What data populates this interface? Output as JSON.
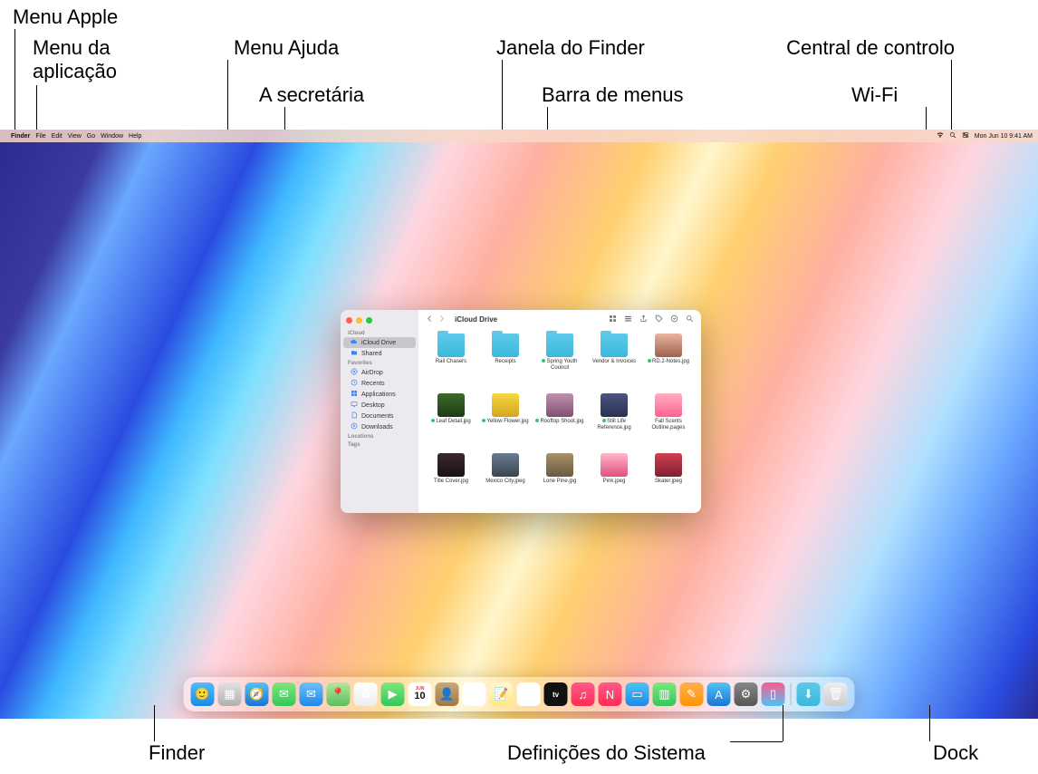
{
  "annotations": {
    "menu_apple": "Menu Apple",
    "menu_app": "Menu da\naplicação",
    "menu_help": "Menu Ajuda",
    "desktop": "A secretária",
    "finder_window": "Janela do Finder",
    "menubar": "Barra de menus",
    "control_center": "Central de controlo",
    "wifi": "Wi-Fi",
    "finder": "Finder",
    "sysprefs": "Definições do Sistema",
    "dock": "Dock"
  },
  "menubar": {
    "items": [
      "Finder",
      "File",
      "Edit",
      "View",
      "Go",
      "Window",
      "Help"
    ],
    "datetime": "Mon Jun 10  9:41 AM"
  },
  "finder": {
    "title": "iCloud Drive",
    "sidebar": {
      "sections": [
        {
          "name": "iCloud",
          "items": [
            {
              "label": "iCloud Drive",
              "icon": "cloud",
              "selected": true
            },
            {
              "label": "Shared",
              "icon": "folder-shared"
            }
          ]
        },
        {
          "name": "Favorites",
          "items": [
            {
              "label": "AirDrop",
              "icon": "airdrop"
            },
            {
              "label": "Recents",
              "icon": "clock"
            },
            {
              "label": "Applications",
              "icon": "app-grid"
            },
            {
              "label": "Desktop",
              "icon": "desktop"
            },
            {
              "label": "Documents",
              "icon": "doc"
            },
            {
              "label": "Downloads",
              "icon": "download"
            }
          ]
        },
        {
          "name": "Locations",
          "items": []
        },
        {
          "name": "Tags",
          "items": []
        }
      ]
    },
    "items": [
      {
        "label": "Rail Chasers",
        "type": "folder",
        "tagged": false
      },
      {
        "label": "Receipts",
        "type": "folder",
        "tagged": false
      },
      {
        "label": "Spring Youth Council",
        "type": "folder",
        "tagged": true
      },
      {
        "label": "Vendor & Invoices",
        "type": "folder",
        "tagged": false
      },
      {
        "label": "RD.2-Notes.jpg",
        "type": "image",
        "tagged": true,
        "bg": "linear-gradient(#e8b4a0,#a06050)"
      },
      {
        "label": "Leaf Detail.jpg",
        "type": "image",
        "tagged": true,
        "bg": "linear-gradient(#3a6b2a,#1e3a15)"
      },
      {
        "label": "Yellow Flower.jpg",
        "type": "image",
        "tagged": true,
        "bg": "linear-gradient(#f5d742,#d4a520)"
      },
      {
        "label": "Rooftop Shoot.jpg",
        "type": "image",
        "tagged": true,
        "bg": "linear-gradient(#c090b0,#805070)"
      },
      {
        "label": "Still Life Reference.jpg",
        "type": "image",
        "tagged": true,
        "bg": "linear-gradient(#4a5580,#2a3050)"
      },
      {
        "label": "Fall Scents Outline.pages",
        "type": "doc",
        "tagged": false,
        "bg": "linear-gradient(#ffb0c0,#ff6090)"
      },
      {
        "label": "Title Cover.jpg",
        "type": "image",
        "tagged": false,
        "bg": "linear-gradient(#3a2a30,#1a1015)"
      },
      {
        "label": "Mexico City.jpeg",
        "type": "image",
        "tagged": false,
        "bg": "linear-gradient(#6a7a90,#3a4550)"
      },
      {
        "label": "Lone Pine.jpg",
        "type": "image",
        "tagged": false,
        "bg": "linear-gradient(#a8906a,#6a5a40)"
      },
      {
        "label": "Pink.jpeg",
        "type": "image",
        "tagged": false,
        "bg": "linear-gradient(#ffb8c8,#e05080)"
      },
      {
        "label": "Skater.jpeg",
        "type": "image",
        "tagged": false,
        "bg": "linear-gradient(#d04050,#802030)"
      }
    ]
  },
  "dock": [
    {
      "name": "finder",
      "bg": "linear-gradient(#4ac0ff,#1e88e5)",
      "glyph": "🙂"
    },
    {
      "name": "launchpad",
      "bg": "linear-gradient(#e0e0e0,#b0b0b0)",
      "glyph": "▦"
    },
    {
      "name": "safari",
      "bg": "linear-gradient(#4fc3f7,#1976d2)",
      "glyph": "🧭"
    },
    {
      "name": "messages",
      "bg": "linear-gradient(#7ce87c,#34c759)",
      "glyph": "✉"
    },
    {
      "name": "mail",
      "bg": "linear-gradient(#6ec0ff,#1e88e5)",
      "glyph": "✉"
    },
    {
      "name": "maps",
      "bg": "linear-gradient(#b0e8a0,#5ac05a)",
      "glyph": "📍"
    },
    {
      "name": "photos",
      "bg": "linear-gradient(#fff,#eee)",
      "glyph": "✿"
    },
    {
      "name": "facetime",
      "bg": "linear-gradient(#7ce87c,#34c759)",
      "glyph": "▶"
    },
    {
      "name": "calendar",
      "bg": "#fff",
      "glyph": "10"
    },
    {
      "name": "contacts",
      "bg": "linear-gradient(#c8a878,#a07848)",
      "glyph": "👤"
    },
    {
      "name": "reminders",
      "bg": "#fff",
      "glyph": "☰"
    },
    {
      "name": "notes",
      "bg": "linear-gradient(#fff8d0,#ffe880)",
      "glyph": "📝"
    },
    {
      "name": "freeform",
      "bg": "#fff",
      "glyph": "◉"
    },
    {
      "name": "tv",
      "bg": "#111",
      "glyph": "tv"
    },
    {
      "name": "music",
      "bg": "linear-gradient(#ff5a8a,#ff2d55)",
      "glyph": "♫"
    },
    {
      "name": "news",
      "bg": "linear-gradient(#ff5a8a,#ff2d55)",
      "glyph": "N"
    },
    {
      "name": "keynote",
      "bg": "linear-gradient(#4fc3f7,#1e88e5)",
      "glyph": "▭"
    },
    {
      "name": "numbers",
      "bg": "linear-gradient(#7ce87c,#34c759)",
      "glyph": "▥"
    },
    {
      "name": "pages",
      "bg": "linear-gradient(#ffb050,#ff9500)",
      "glyph": "✎"
    },
    {
      "name": "appstore",
      "bg": "linear-gradient(#4fc3f7,#1976d2)",
      "glyph": "A"
    },
    {
      "name": "system-settings",
      "bg": "linear-gradient(#888,#555)",
      "glyph": "⚙"
    },
    {
      "name": "iphone-mirror",
      "bg": "linear-gradient(#ff5a8a,#4fc3f7)",
      "glyph": "▯"
    },
    {
      "name": "separator"
    },
    {
      "name": "downloads",
      "bg": "linear-gradient(#5ec9e8,#3bb8dd)",
      "glyph": "⬇"
    },
    {
      "name": "trash",
      "bg": "linear-gradient(#eee,#ccc)",
      "glyph": "🗑"
    }
  ]
}
